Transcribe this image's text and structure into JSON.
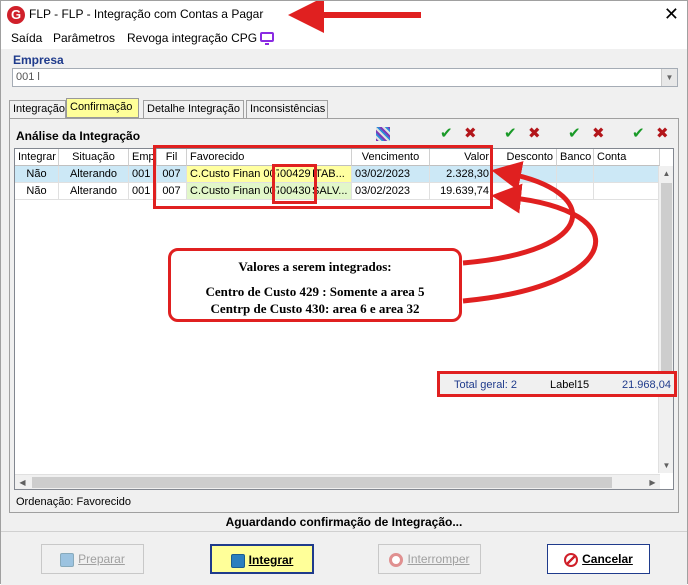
{
  "window": {
    "title": "FLP -  FLP - Integração com Contas a Pagar",
    "app_icon": "G"
  },
  "menu": {
    "items": [
      "Saída",
      "Parâmetros",
      "Revoga integração CPG"
    ]
  },
  "empresa": {
    "label": "Empresa",
    "value": "001 l"
  },
  "tabs": [
    "Integração",
    "Confirmação",
    "Detalhe Integração",
    "Inconsistências"
  ],
  "active_tab": "Confirmação",
  "analysis": {
    "title": "Análise da Integração",
    "columns": [
      "Integrar",
      "Situação",
      "Emp",
      "Fil",
      "Favorecido",
      "Vencimento",
      "Valor",
      "Desconto",
      "Banco",
      "Conta"
    ],
    "rows": [
      {
        "integrar": "Não",
        "situacao": "Alterando",
        "emp": "001",
        "fil": "007",
        "fav_a": "C.Custo Finan 007",
        "fav_b": "00429",
        "fav_c": "ITAB...",
        "vencimento": "03/02/2023",
        "valor": "2.328,30"
      },
      {
        "integrar": "Não",
        "situacao": "Alterando",
        "emp": "001",
        "fil": "007",
        "fav_a": "C.Custo Finan 007",
        "fav_b": "00430",
        "fav_c": "SALV...",
        "vencimento": "03/02/2023",
        "valor": "19.639,74"
      }
    ]
  },
  "status": {
    "ordering": "Ordenação: Favorecido",
    "total_label": "Total geral: 2",
    "label15": "Label15",
    "total_value": "21.968,04",
    "message": "Aguardando confirmação de Integração..."
  },
  "buttons": {
    "prepare": "Preparar",
    "integrate": "Integrar",
    "interrupt": "Interromper",
    "cancel": "Cancelar"
  },
  "callout": {
    "title": "Valores a serem integrados:",
    "line1": "Centro de Custo 429 : Somente a area 5",
    "line2": "Centrp de Custo 430: area 6 e area 32"
  },
  "colors": {
    "annotation_red": "#e02020",
    "selected_row": "#cce8f6",
    "highlight_yellow": "#ffffa0",
    "accent_blue": "#1f3b8c"
  }
}
